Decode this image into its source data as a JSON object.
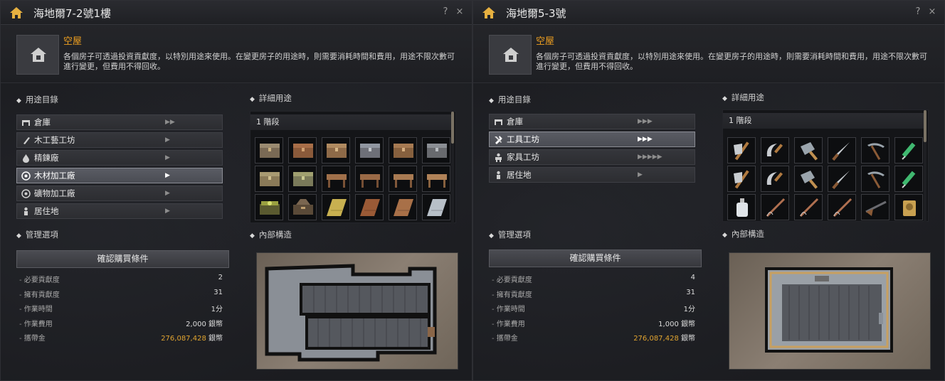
{
  "panels": [
    {
      "title": "海地爾7-2號1樓",
      "status_title": "空屋",
      "status_desc": "各個房子可透過投資貢獻度，以特別用途來使用。在變更房子的用途時，則需要消耗時間和費用，用途不限次數可進行變更，但費用不得回收。",
      "purpose_label": "用途目錄",
      "detail_label": "詳細用途",
      "manage_label": "管理選項",
      "interior_label": "內部構造",
      "tier": "1 階段",
      "purposes": [
        {
          "label": "倉庫",
          "icon": "warehouse-icon",
          "arrows": "▶▶",
          "selected": false
        },
        {
          "label": "木工藝工坊",
          "icon": "woodcraft-icon",
          "arrows": "▶",
          "selected": false
        },
        {
          "label": "精鍊廠",
          "icon": "refinery-icon",
          "arrows": "▶",
          "selected": false
        },
        {
          "label": "木材加工廠",
          "icon": "lumber-icon",
          "arrows": "▶",
          "selected": true
        },
        {
          "label": "礦物加工廠",
          "icon": "mineral-icon",
          "arrows": "▶",
          "selected": false
        },
        {
          "label": "居住地",
          "icon": "residence-icon",
          "arrows": "▶",
          "selected": false
        }
      ],
      "confirm_label": "確認購買條件",
      "stats": [
        {
          "label": "必要貢獻度",
          "value": "2",
          "gold": "",
          "unit": ""
        },
        {
          "label": "擁有貢獻度",
          "value": "31",
          "gold": "",
          "unit": ""
        },
        {
          "label": "作業時間",
          "value": "1分",
          "gold": "",
          "unit": ""
        },
        {
          "label": "作業費用",
          "value": "2,000",
          "gold": "",
          "unit": " 銀幣"
        },
        {
          "label": "攜帶金",
          "value": "",
          "gold": "276,087,428",
          "unit": " 銀幣"
        }
      ],
      "items": [
        "chest-icon",
        "chest-icon",
        "chest-icon",
        "chest-icon",
        "chest-icon",
        "chest-icon",
        "chest-icon",
        "chest-icon",
        "workbench-icon",
        "workbench-icon",
        "workbench-icon",
        "workbench-icon",
        "green-chest-icon",
        "tool-chest-icon",
        "gold-plank-icon",
        "wood-plank-icon",
        "wood-plank-icon",
        "stone-plank-icon"
      ]
    },
    {
      "title": "海地爾5-3號",
      "status_title": "空屋",
      "status_desc": "各個房子可透過投資貢獻度，以特別用途來使用。在變更房子的用途時，則需要消耗時間和費用，用途不限次數可進行變更，但費用不得回收。",
      "purpose_label": "用途目錄",
      "detail_label": "詳細用途",
      "manage_label": "管理選項",
      "interior_label": "內部構造",
      "tier": "1 階段",
      "purposes": [
        {
          "label": "倉庫",
          "icon": "warehouse-icon",
          "arrows": "▶▶▶",
          "selected": false
        },
        {
          "label": "工具工坊",
          "icon": "tools-icon",
          "arrows": "▶▶▶",
          "selected": true
        },
        {
          "label": "家具工坊",
          "icon": "furniture-icon",
          "arrows": "▶▶▶▶▶",
          "selected": false
        },
        {
          "label": "居住地",
          "icon": "residence-icon",
          "arrows": "▶",
          "selected": false
        }
      ],
      "confirm_label": "確認購買條件",
      "stats": [
        {
          "label": "必要貢獻度",
          "value": "4",
          "gold": "",
          "unit": ""
        },
        {
          "label": "擁有貢獻度",
          "value": "31",
          "gold": "",
          "unit": ""
        },
        {
          "label": "作業時間",
          "value": "1分",
          "gold": "",
          "unit": ""
        },
        {
          "label": "作業費用",
          "value": "1,000",
          "gold": "",
          "unit": " 銀幣"
        },
        {
          "label": "攜帶金",
          "value": "",
          "gold": "276,087,428",
          "unit": " 銀幣"
        }
      ],
      "items": [
        "axe-icon",
        "sickle-icon",
        "cleaver-icon",
        "knife-icon",
        "pickaxe-icon",
        "syringe-icon",
        "axe-icon",
        "sickle-icon",
        "cleaver-icon",
        "knife-icon",
        "pickaxe-icon",
        "syringe-icon",
        "bottle-icon",
        "fishing-rod-icon",
        "fishing-rod-icon",
        "fishing-rod-icon",
        "musket-icon",
        "gold-trinket-icon"
      ]
    }
  ],
  "help_glyph": "?",
  "close_glyph": "×",
  "colors": {
    "accent": "#f0a020",
    "gold_text": "#e0a430",
    "panel_bg": "#1b1c20"
  }
}
